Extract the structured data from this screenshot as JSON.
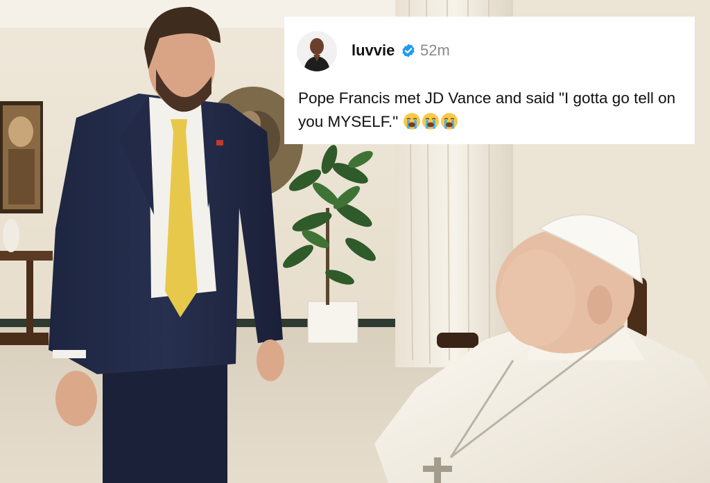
{
  "post": {
    "username": "luvvie",
    "time_ago": "52m",
    "verified_icon": "verified-badge-icon",
    "text": "Pope Francis met JD Vance and said \"I gotta go tell on you MYSELF.\"",
    "emoji_names": [
      "loudly-crying-face-icon",
      "loudly-crying-face-icon",
      "loudly-crying-face-icon"
    ],
    "colors": {
      "verified": "#1d9bf0",
      "time": "#8a8a8a",
      "card": "#ffffff"
    }
  }
}
